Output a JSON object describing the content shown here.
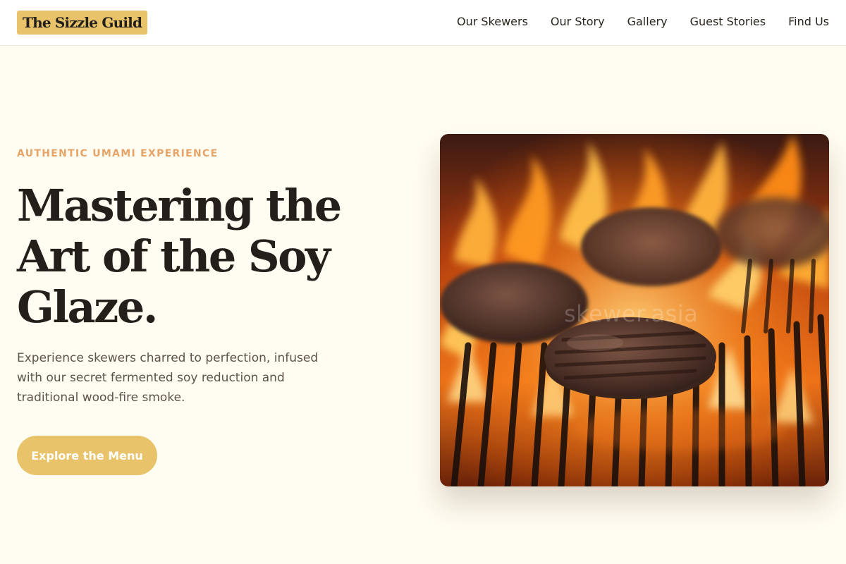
{
  "header": {
    "logo": "The Sizzle Guild",
    "nav": [
      {
        "label": "Our Skewers"
      },
      {
        "label": "Our Story"
      },
      {
        "label": "Gallery"
      },
      {
        "label": "Guest Stories"
      },
      {
        "label": "Find Us"
      }
    ]
  },
  "hero": {
    "eyebrow": "AUTHENTIC UMAMI EXPERIENCE",
    "headline_lines": [
      "Mastering the",
      "Art of the Soy",
      "Glaze."
    ],
    "subtext": "Experience skewers charred to perfection, infused with our secret fermented soy reduction and traditional wood-fire smoke.",
    "cta_label": "Explore the Menu",
    "image": {
      "subject": "burger patties grilling over open flames",
      "watermark": "skewer.asia"
    }
  },
  "colors": {
    "page_background": "#fffcf1",
    "header_background": "#ffffff",
    "accent": "#e8c36a",
    "eyebrow": "#e6a468",
    "heading": "#23201c",
    "body_text": "#5c544c"
  }
}
